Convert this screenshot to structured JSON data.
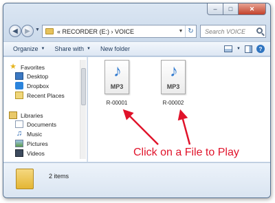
{
  "addressbar": {
    "breadcrumb": "«  RECORDER (E:)  ›  VOICE",
    "search_placeholder": "Search VOICE"
  },
  "toolbar": {
    "organize_label": "Organize",
    "share_label": "Share with",
    "new_folder_label": "New folder"
  },
  "navigation": {
    "favorites_label": "Favorites",
    "desktop_label": "Desktop",
    "dropbox_label": "Dropbox",
    "recent_label": "Recent Places",
    "libraries_label": "Libraries",
    "documents_label": "Documents",
    "music_label": "Music",
    "pictures_label": "Pictures",
    "videos_label": "Videos"
  },
  "files": [
    {
      "name": "R-00001",
      "type_label": "MP3"
    },
    {
      "name": "R-00002",
      "type_label": "MP3"
    }
  ],
  "annotation": {
    "text": "Click on a File to Play",
    "color": "#e0132a"
  },
  "details": {
    "item_count": "2 items"
  }
}
